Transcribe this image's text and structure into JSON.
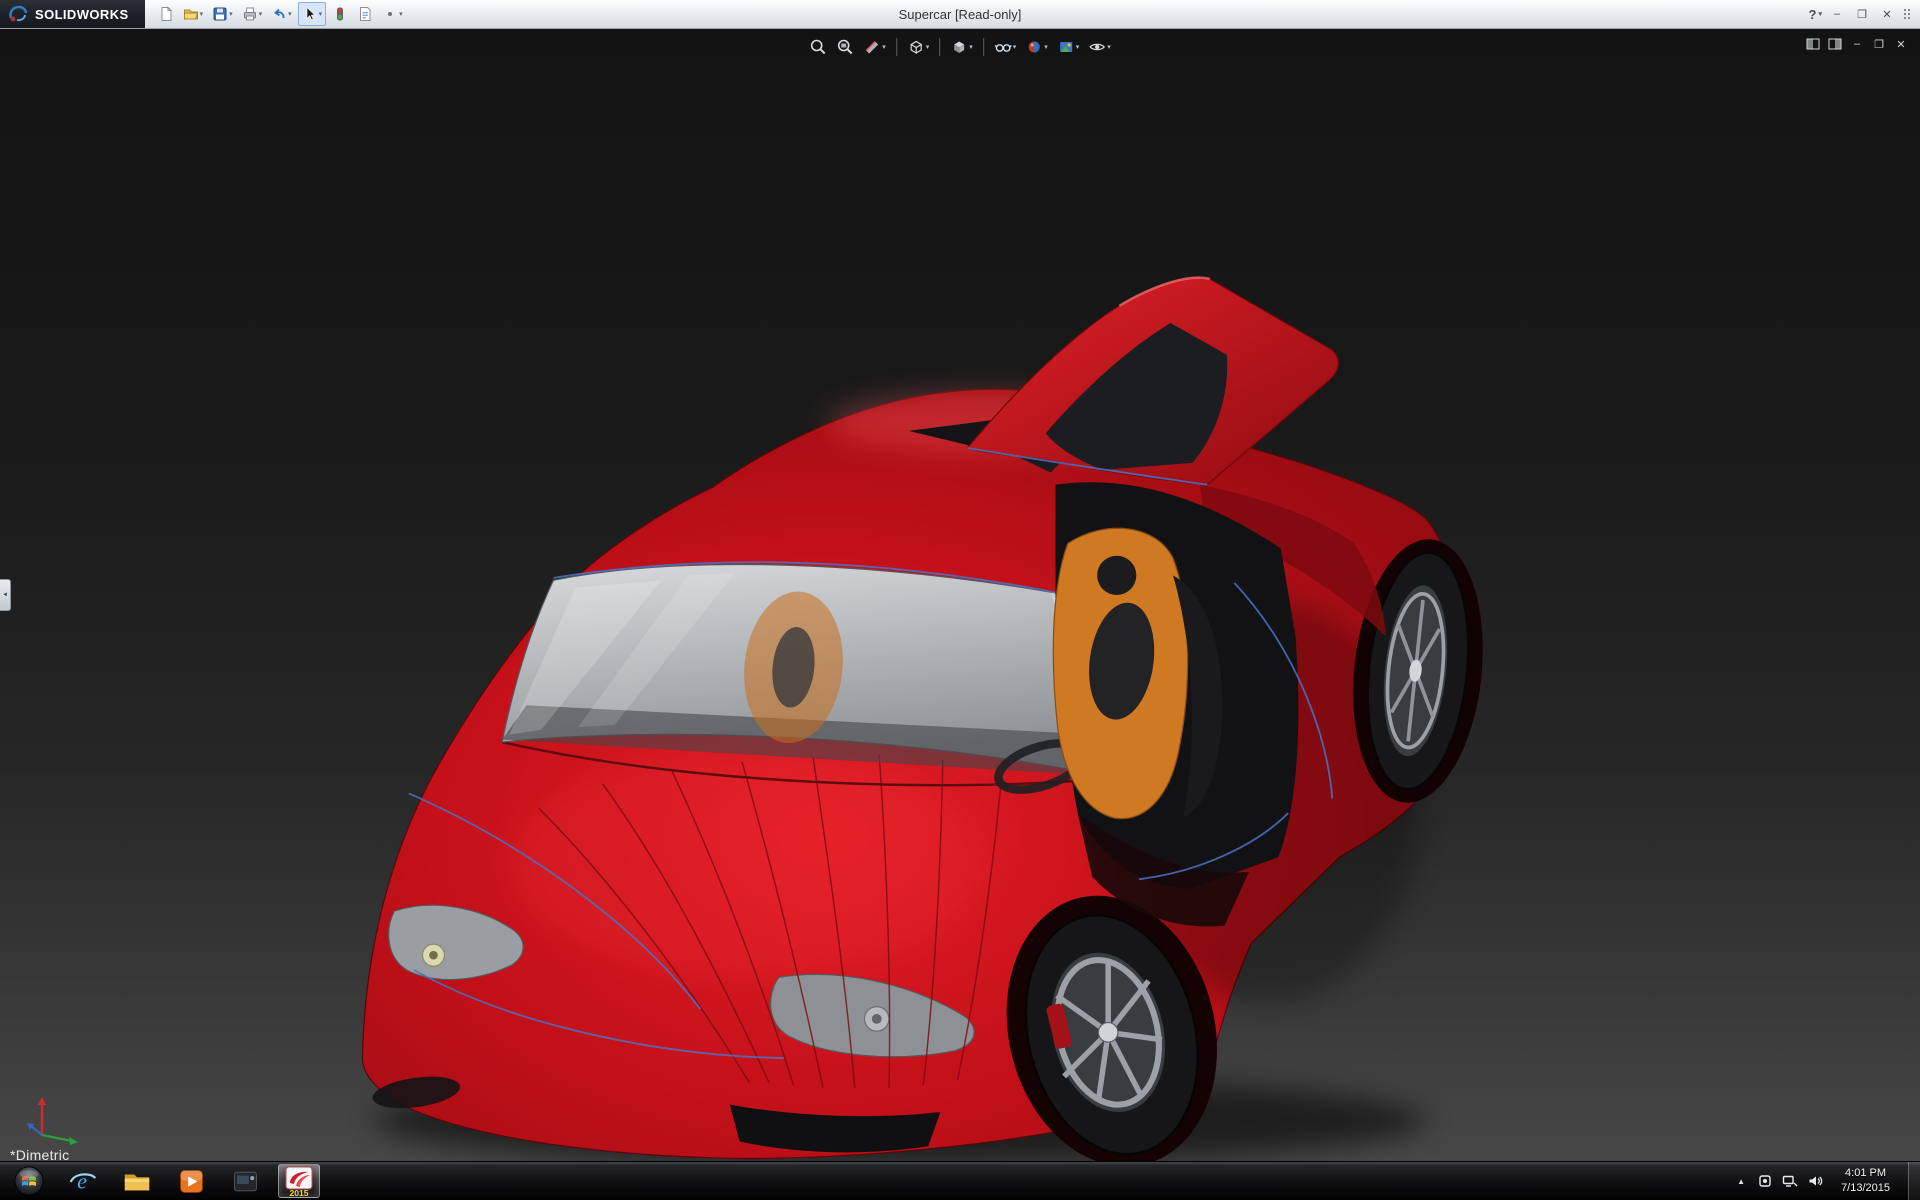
{
  "window": {
    "brand": "SOLIDWORKS",
    "title": "Supercar [Read-only]"
  },
  "titlebar": {
    "tools": [
      "new-document",
      "open",
      "save",
      "print",
      "undo",
      "select",
      "rebuild",
      "file-properties",
      "options"
    ],
    "window_controls": [
      "help",
      "minimize",
      "restore",
      "close"
    ]
  },
  "glyphs": {
    "caret": "▾",
    "help": "?",
    "minimize": "–",
    "restore": "❐",
    "close": "✕",
    "tray_expand": "▲",
    "pane_collapse": "◄"
  },
  "heads_up": {
    "icons": [
      "zoom-to-fit",
      "zoom-to-area",
      "section-view",
      "view-orientation",
      "display-style",
      "hide-show-items",
      "edit-appearance",
      "apply-scene",
      "view-settings"
    ]
  },
  "viewport": {
    "view_label": "*Dimetric",
    "model": "Supercar",
    "colors": {
      "body_red": "#c31019",
      "interior_orange": "#d1751f",
      "glass_gray": "#b9bbbd",
      "background_top": "#131313",
      "background_bottom": "#474747"
    }
  },
  "document_controls": [
    "split-pane-left",
    "split-pane-right",
    "minimize",
    "restore",
    "close"
  ],
  "taskbar": {
    "items": [
      "start",
      "internet-explorer",
      "file-explorer",
      "media-player",
      "screenshot-tool",
      "solidworks-2015"
    ],
    "active_item": "solidworks-2015",
    "sw_badge": "2015",
    "tray": {
      "time": "4:01 PM",
      "date": "7/13/2015"
    }
  }
}
